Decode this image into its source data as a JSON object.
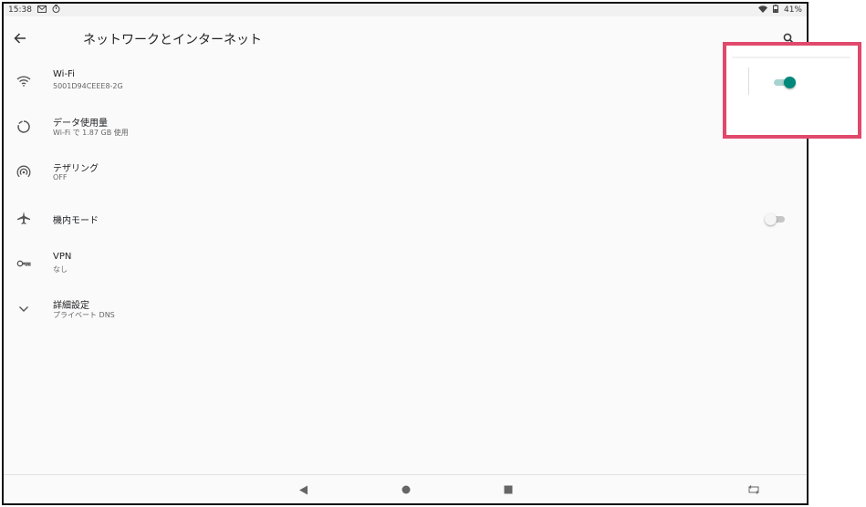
{
  "status_bar": {
    "time": "15:38",
    "battery": "41%",
    "icons": [
      "gmail-icon",
      "timer-icon",
      "wifi-icon",
      "battery-icon"
    ]
  },
  "app_bar": {
    "title": "ネットワークとインターネット",
    "back_icon": "arrow-back-icon",
    "search_icon": "search-icon"
  },
  "settings": {
    "items": [
      {
        "id": "wifi",
        "icon": "wifi-icon",
        "title": "Wi-Fi",
        "summary": "5001D94CEEE8-2G",
        "toggle": "on"
      },
      {
        "id": "data-usage",
        "icon": "data-usage-icon",
        "title": "データ使用量",
        "summary": "Wi-Fi で 1.87 GB 使用"
      },
      {
        "id": "tethering",
        "icon": "hotspot-icon",
        "title": "テザリング",
        "summary": "OFF"
      },
      {
        "id": "airplane",
        "icon": "airplane-icon",
        "title": "機内モード",
        "summary": "",
        "toggle": "off"
      },
      {
        "id": "vpn",
        "icon": "vpn-key-icon",
        "title": "VPN",
        "summary": "なし"
      },
      {
        "id": "advanced",
        "icon": "chevron-down-icon",
        "title": "詳細設定",
        "summary": "プライベート DNS"
      }
    ]
  },
  "nav_bar": {
    "buttons": [
      "nav-back-icon",
      "nav-home-icon",
      "nav-recents-icon",
      "rotate-icon"
    ]
  },
  "colors": {
    "accent": "#00897b",
    "accent_track": "#a6d3cf",
    "highlight": "#e0496b"
  }
}
